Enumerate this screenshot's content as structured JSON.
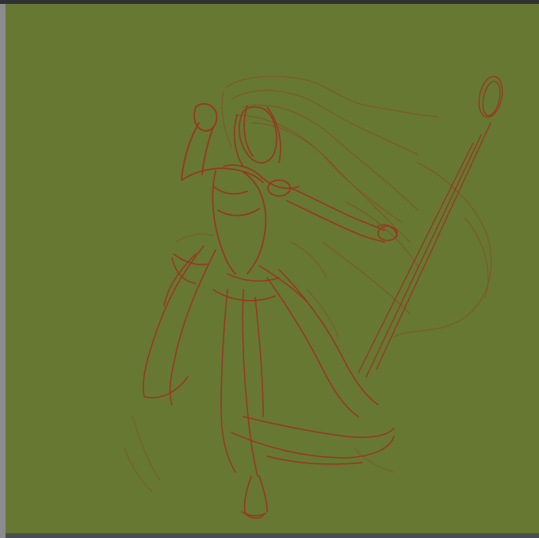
{
  "canvas": {
    "background_color": "#667832",
    "stroke_color": "#b0281c"
  },
  "artwork": {
    "icon": "figure-sketch"
  }
}
